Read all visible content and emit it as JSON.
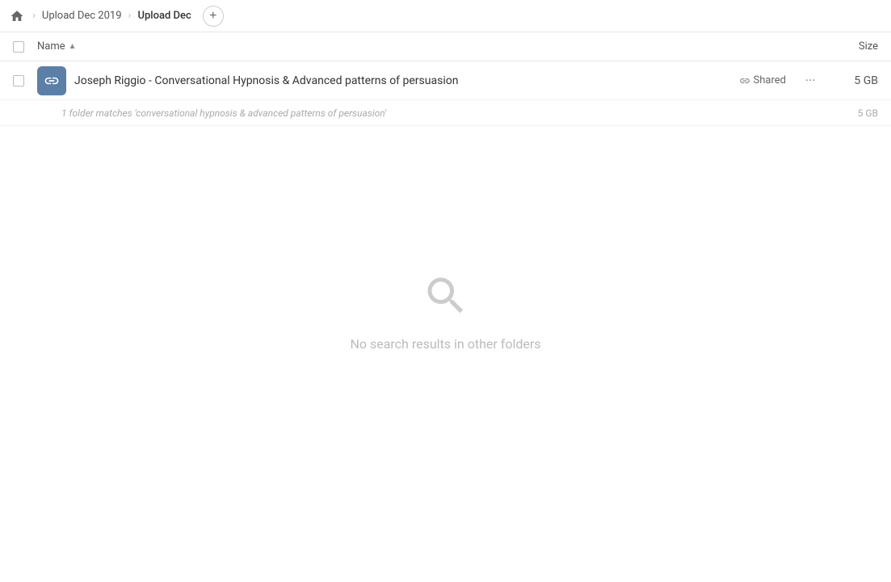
{
  "breadcrumb": {
    "home_label": "Home",
    "items": [
      {
        "label": "Upload Dec 2019",
        "current": false
      },
      {
        "label": "Upload Dec",
        "current": true
      }
    ],
    "add_button_label": "+"
  },
  "columns": {
    "name_label": "Name",
    "size_label": "Size"
  },
  "file_row": {
    "name": "Joseph Riggio - Conversational Hypnosis & Advanced patterns of persuasion",
    "shared_label": "Shared",
    "size": "5 GB",
    "more_options_label": "···"
  },
  "match_info": {
    "text": "1 folder matches 'conversational hypnosis & advanced patterns of persuasion'",
    "size": "5 GB"
  },
  "empty_state": {
    "message": "No search results in other folders"
  }
}
